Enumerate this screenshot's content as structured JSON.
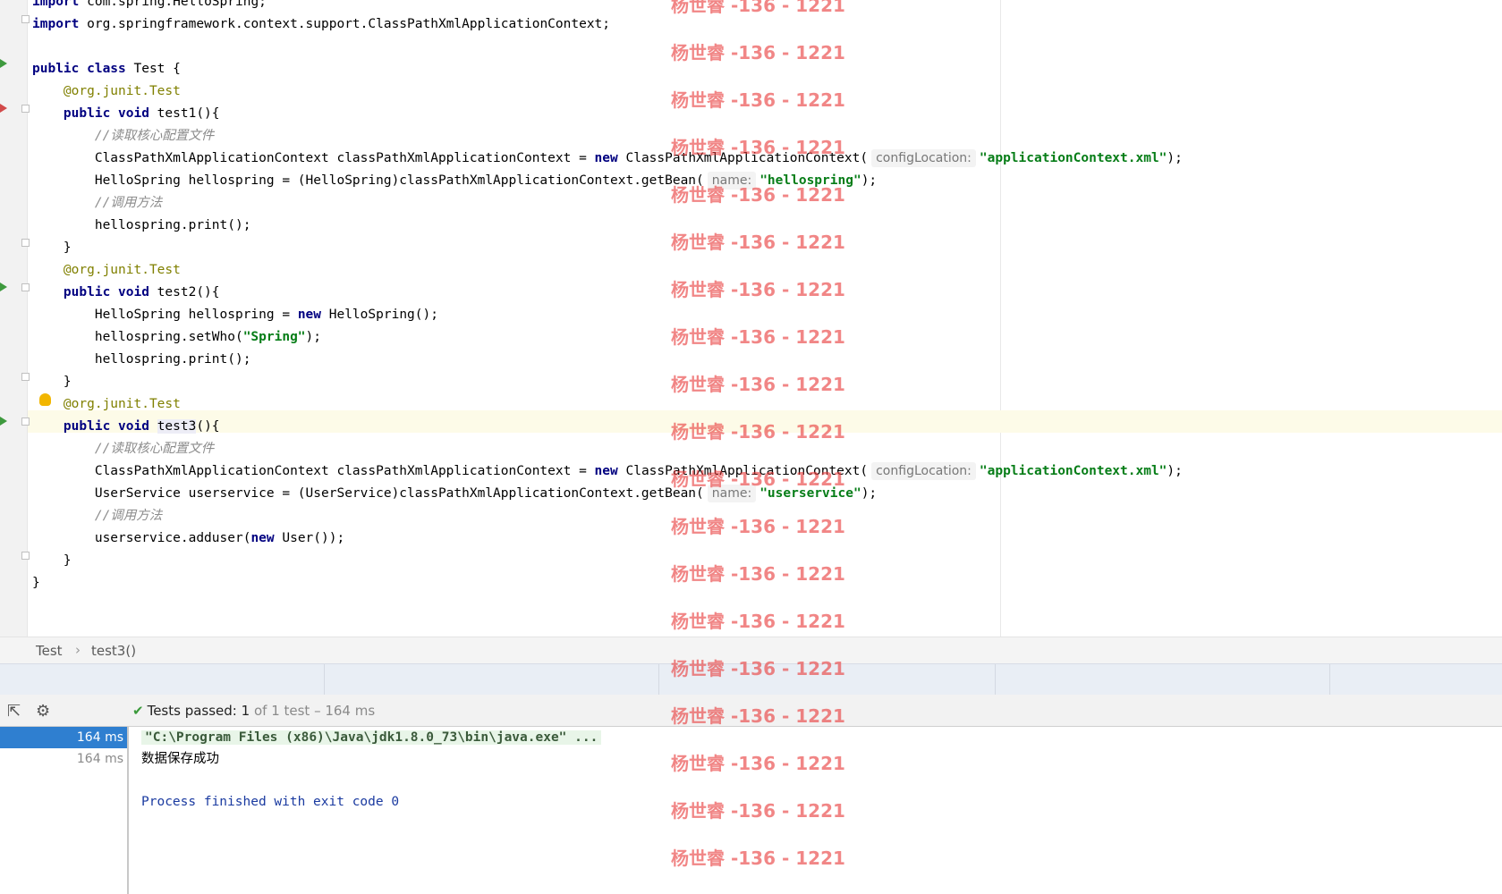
{
  "editor": {
    "lines": [
      {
        "parts": [
          {
            "t": "import",
            "c": "kw"
          },
          {
            "t": " com.spring.HelloSpring;",
            "c": ""
          }
        ]
      },
      {
        "parts": [
          {
            "t": "import",
            "c": "kw"
          },
          {
            "t": " org.springframework.context.support.ClassPathXmlApplicationContext;",
            "c": ""
          }
        ]
      },
      {
        "parts": []
      },
      {
        "parts": [
          {
            "t": "public class",
            "c": "kw"
          },
          {
            "t": " Test {",
            "c": ""
          }
        ]
      },
      {
        "parts": [
          {
            "t": "    "
          },
          {
            "t": "@org.junit.",
            "c": "ann"
          },
          {
            "t": "Test",
            "c": "ann"
          }
        ]
      },
      {
        "parts": [
          {
            "t": "    "
          },
          {
            "t": "public void",
            "c": "kw"
          },
          {
            "t": " test1(){",
            "c": ""
          }
        ]
      },
      {
        "parts": [
          {
            "t": "        "
          },
          {
            "t": "//读取核心配置文件",
            "c": "cmt"
          }
        ]
      },
      {
        "parts": [
          {
            "t": "        ClassPathXmlApplicationContext classPathXmlApplicationContext = "
          },
          {
            "t": "new",
            "c": "kw"
          },
          {
            "t": " ClassPathXmlApplicationContext("
          },
          {
            "t": "configLocation:",
            "c": "hint"
          },
          {
            "t": "\"applicationContext.xml\"",
            "c": "str"
          },
          {
            "t": ");"
          }
        ]
      },
      {
        "parts": [
          {
            "t": "        HelloSpring hellospring = (HelloSpring)classPathXmlApplicationContext.getBean("
          },
          {
            "t": "name:",
            "c": "hint"
          },
          {
            "t": "\"hellospring\"",
            "c": "str"
          },
          {
            "t": ");"
          }
        ]
      },
      {
        "parts": [
          {
            "t": "        "
          },
          {
            "t": "//调用方法",
            "c": "cmt"
          }
        ]
      },
      {
        "parts": [
          {
            "t": "        hellospring.print();"
          }
        ]
      },
      {
        "parts": [
          {
            "t": "    }"
          }
        ]
      },
      {
        "parts": [
          {
            "t": "    "
          },
          {
            "t": "@org.junit.",
            "c": "ann"
          },
          {
            "t": "Test",
            "c": "ann"
          }
        ]
      },
      {
        "parts": [
          {
            "t": "    "
          },
          {
            "t": "public void",
            "c": "kw"
          },
          {
            "t": " test2(){"
          }
        ]
      },
      {
        "parts": [
          {
            "t": "        HelloSpring hellospring = "
          },
          {
            "t": "new",
            "c": "kw"
          },
          {
            "t": " HelloSpring();"
          }
        ]
      },
      {
        "parts": [
          {
            "t": "        hellospring.setWho("
          },
          {
            "t": "\"Spring\"",
            "c": "str"
          },
          {
            "t": ");"
          }
        ]
      },
      {
        "parts": [
          {
            "t": "        hellospring.print();"
          }
        ]
      },
      {
        "parts": [
          {
            "t": "    }"
          }
        ]
      },
      {
        "parts": [
          {
            "t": "    "
          },
          {
            "t": "@org.junit.",
            "c": "ann"
          },
          {
            "t": "Test",
            "c": "ann"
          }
        ]
      },
      {
        "parts": [
          {
            "t": "    "
          },
          {
            "t": "public void",
            "c": "kw"
          },
          {
            "t": " "
          },
          {
            "t": "test3",
            "c": "ident-hl"
          },
          {
            "t": "(){"
          }
        ]
      },
      {
        "parts": [
          {
            "t": "        "
          },
          {
            "t": "//读取核心配置文件",
            "c": "cmt"
          }
        ]
      },
      {
        "parts": [
          {
            "t": "        ClassPathXmlApplicationContext classPathXmlApplicationContext = "
          },
          {
            "t": "new",
            "c": "kw"
          },
          {
            "t": " ClassPathXmlApplicationContext("
          },
          {
            "t": "configLocation:",
            "c": "hint"
          },
          {
            "t": "\"applicationContext.xml\"",
            "c": "str"
          },
          {
            "t": ");"
          }
        ]
      },
      {
        "parts": [
          {
            "t": "        UserService userservice = (UserService)classPathXmlApplicationContext.getBean("
          },
          {
            "t": "name:",
            "c": "hint"
          },
          {
            "t": "\"userservice\"",
            "c": "str"
          },
          {
            "t": ");"
          }
        ]
      },
      {
        "parts": [
          {
            "t": "        "
          },
          {
            "t": "//调用方法",
            "c": "cmt"
          }
        ]
      },
      {
        "parts": [
          {
            "t": "        userservice.adduser("
          },
          {
            "t": "new",
            "c": "kw"
          },
          {
            "t": " User());"
          }
        ]
      },
      {
        "parts": [
          {
            "t": "    }"
          }
        ]
      },
      {
        "parts": [
          {
            "t": "}"
          }
        ]
      }
    ]
  },
  "watermark": {
    "text": "杨世睿 -136 - 1221",
    "color": "#e83c3c"
  },
  "breadcrumb": {
    "items": [
      "Test",
      "test3()"
    ],
    "separator": "›"
  },
  "run_panel": {
    "status_prefix": "Tests passed:",
    "status_count": "1",
    "status_rest": "of 1 test – 164 ms",
    "tree": [
      {
        "label": "164 ms",
        "selected": true
      },
      {
        "label": "164 ms",
        "selected": false
      }
    ],
    "console": {
      "command": "\"C:\\Program Files (x86)\\Java\\jdk1.8.0_73\\bin\\java.exe\" ...",
      "output": "数据保存成功",
      "exit": "Process finished with exit code 0"
    },
    "icons": {
      "export": "export-icon",
      "settings": "gear-icon",
      "passed": "check-icon"
    }
  }
}
